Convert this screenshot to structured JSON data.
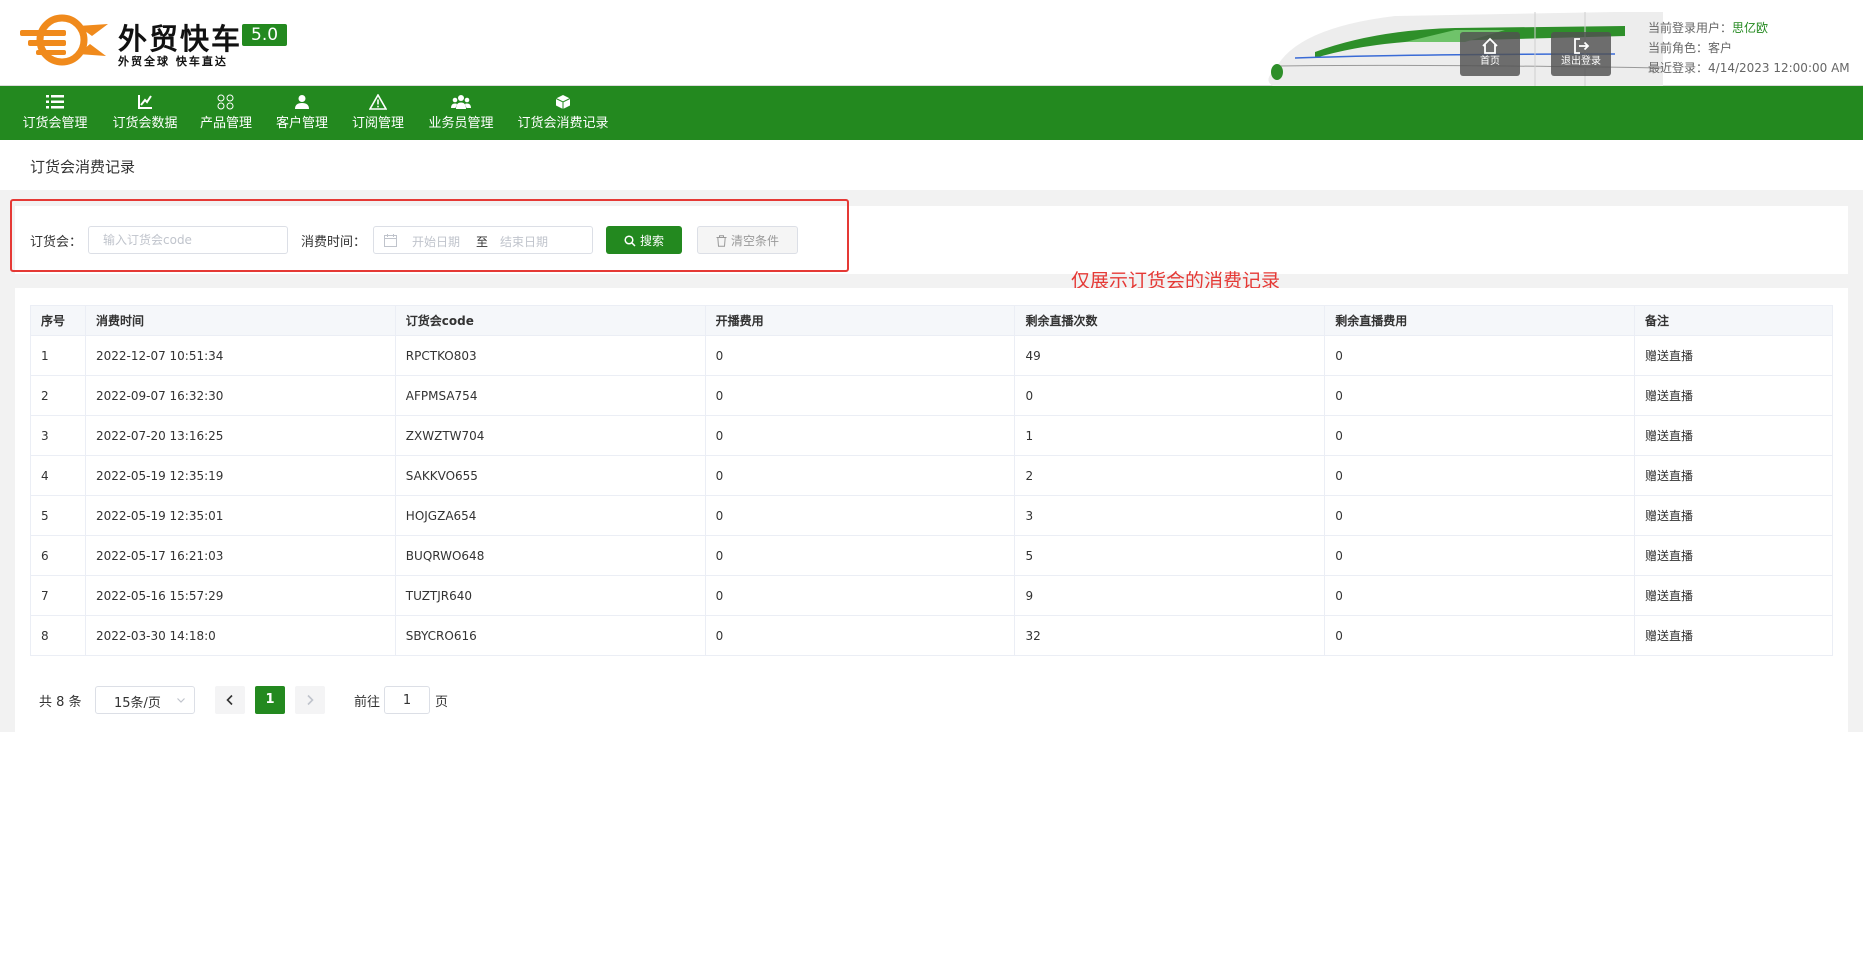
{
  "brand": {
    "name": "外贸快车",
    "version": "5.0",
    "tagline": "外贸全球 快车直达",
    "color_green": "#23891f",
    "color_orange": "#f08a1c"
  },
  "header": {
    "home_label": "首页",
    "logout_label": "退出登录",
    "user_label": "当前登录用户：",
    "user_name": "思亿欧",
    "role_label": "当前角色：",
    "role_value": "客户",
    "last_login_label": "最近登录：",
    "last_login_value": "4/14/2023 12:00:00 AM"
  },
  "nav": {
    "items": [
      {
        "label": "订货会管理",
        "icon": "list-icon"
      },
      {
        "label": "订货会数据",
        "icon": "chart-icon"
      },
      {
        "label": "产品管理",
        "icon": "grid-icon"
      },
      {
        "label": "客户管理",
        "icon": "user-icon"
      },
      {
        "label": "订阅管理",
        "icon": "warning-icon"
      },
      {
        "label": "业务员管理",
        "icon": "group-icon"
      },
      {
        "label": "订货会消费记录",
        "icon": "cube-icon"
      }
    ]
  },
  "page": {
    "title": "订货会消费记录"
  },
  "search": {
    "fair_label": "订货会：",
    "fair_placeholder": "输入订货会code",
    "time_label": "消费时间：",
    "start_placeholder": "开始日期",
    "separator": "至",
    "end_placeholder": "结束日期",
    "search_button": "搜索",
    "clear_button": "清空条件"
  },
  "annotation": "仅展示订货会的消费记录",
  "table": {
    "columns": [
      "序号",
      "消费时间",
      "订货会code",
      "开播费用",
      "剩余直播次数",
      "剩余直播费用",
      "备注"
    ],
    "rows": [
      [
        "1",
        "2022-12-07 10:51:34",
        "RPCTKO803",
        "0",
        "49",
        "0",
        "赠送直播"
      ],
      [
        "2",
        "2022-09-07 16:32:30",
        "AFPMSA754",
        "0",
        "0",
        "0",
        "赠送直播"
      ],
      [
        "3",
        "2022-07-20 13:16:25",
        "ZXWZTW704",
        "0",
        "1",
        "0",
        "赠送直播"
      ],
      [
        "4",
        "2022-05-19 12:35:19",
        "SAKKVO655",
        "0",
        "2",
        "0",
        "赠送直播"
      ],
      [
        "5",
        "2022-05-19 12:35:01",
        "HOJGZA654",
        "0",
        "3",
        "0",
        "赠送直播"
      ],
      [
        "6",
        "2022-05-17 16:21:03",
        "BUQRWO648",
        "0",
        "5",
        "0",
        "赠送直播"
      ],
      [
        "7",
        "2022-05-16 15:57:29",
        "TUZTJR640",
        "0",
        "9",
        "0",
        "赠送直播"
      ],
      [
        "8",
        "2022-03-30 14:18:0",
        "SBYCRO616",
        "0",
        "32",
        "0",
        "赠送直播"
      ]
    ]
  },
  "pager": {
    "total": "共 8 条",
    "page_size": "15条/页",
    "current_page": "1",
    "goto_label": "前往",
    "goto_value": "1",
    "page_suffix": "页"
  }
}
